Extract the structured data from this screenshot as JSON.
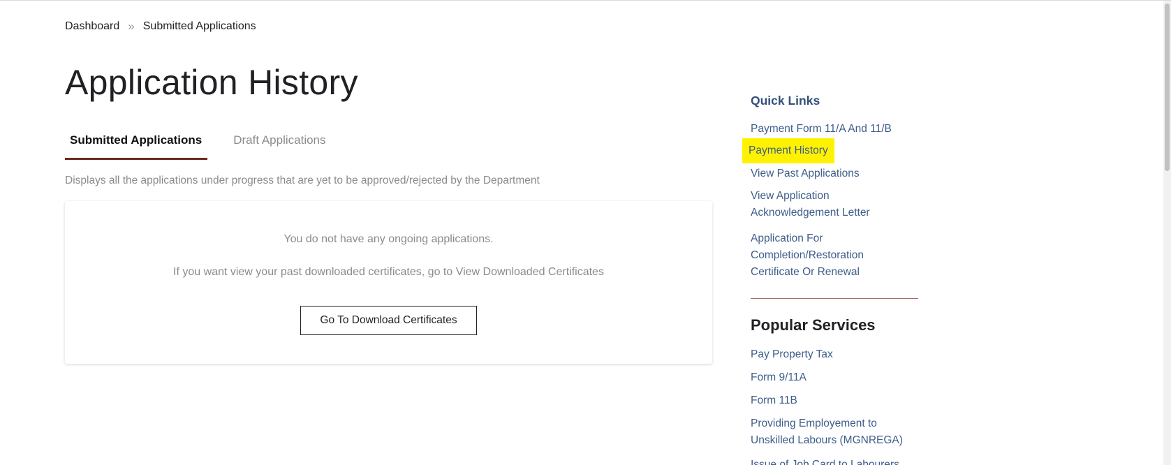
{
  "breadcrumb": {
    "home": "Dashboard",
    "separator": "»",
    "current": "Submitted Applications"
  },
  "page_title": "Application History",
  "tabs": [
    {
      "label": "Submitted Applications",
      "active": true
    },
    {
      "label": "Draft Applications",
      "active": false
    }
  ],
  "description": "Displays all the applications under progress that are yet to be approved/rejected by the Department",
  "empty_state": {
    "message": "You do not have any ongoing applications.",
    "hint": "If you want view your past downloaded certificates, go to View Downloaded Certificates",
    "button_label": "Go To Download Certificates"
  },
  "quick_links": {
    "title": "Quick Links",
    "items": [
      {
        "lines": [
          "Payment Form 11/A And 11/B"
        ]
      },
      {
        "lines": [
          "Payment History"
        ],
        "highlighted": true
      },
      {
        "lines": [
          "View Past Applications"
        ]
      },
      {
        "lines": [
          "View Application",
          "Acknowledgement Letter"
        ]
      },
      {
        "lines": [
          "Application For",
          "Completion/Restoration",
          "Certificate Or Renewal"
        ]
      }
    ]
  },
  "popular_services": {
    "title": "Popular Services",
    "items": [
      {
        "lines": [
          "Pay Property Tax"
        ]
      },
      {
        "lines": [
          "Form 9/11A"
        ]
      },
      {
        "lines": [
          "Form 11B"
        ]
      },
      {
        "lines": [
          "Providing Employement to",
          "Unskilled Labours (MGNREGA)"
        ]
      },
      {
        "lines": [
          "Issue of Job Card to Labourers"
        ]
      }
    ]
  },
  "colors": {
    "link": "#3e5d8a",
    "quick_links_title": "#344f7c",
    "highlight": "#fff200",
    "active_tab_underline": "#6a2a22",
    "divider": "#a86d66"
  }
}
